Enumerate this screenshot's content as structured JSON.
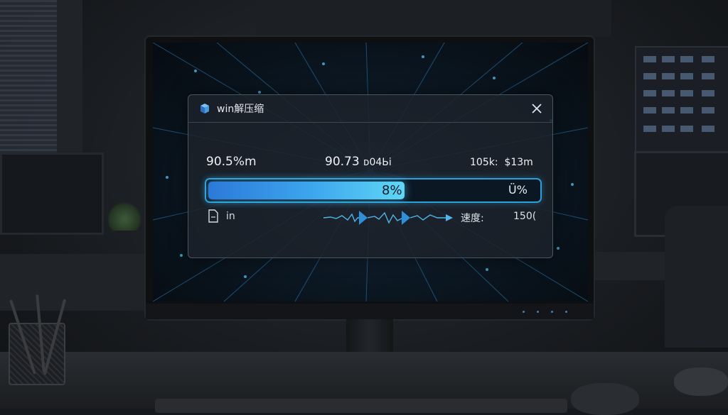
{
  "app": {
    "title": "win解压缩",
    "icon": "package-box-icon",
    "close_icon": "close-icon"
  },
  "stats": {
    "left": "90.5%m",
    "middle": "90.73",
    "middle_suffix": "ᴅ04Ьi",
    "right": "105k:  $13m"
  },
  "progress": {
    "value_fraction": 0.6,
    "label": "8%",
    "right_label": "Ü%"
  },
  "file": {
    "icon": "file-icon",
    "name": "in"
  },
  "speed": {
    "label": "速度:",
    "value": "150("
  },
  "colors": {
    "accent": "#2f9fd8",
    "fill_start": "#2c79d8",
    "fill_end": "#5fd7f5",
    "dialog_bg": "#1c222a"
  }
}
